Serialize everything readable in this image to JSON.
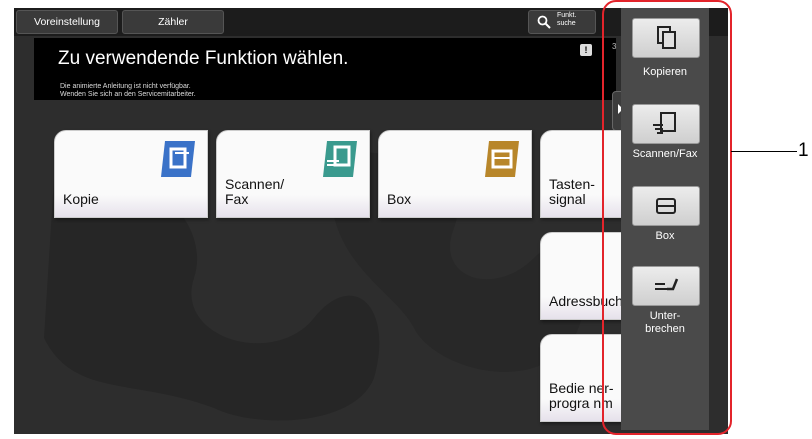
{
  "topbar": {
    "preset_label": "Voreinstellung",
    "counter_label": "Zähler",
    "search_label_line1": "Funkt.",
    "search_label_line2": "suche",
    "right_number": "3"
  },
  "header": {
    "title": "Zu verwendende Funktion wählen.",
    "notice_line1": "Die animierte Anleitung ist nicht verfügbar.",
    "notice_line2": "Wenden Sie sich an den Servicemitarbeiter."
  },
  "tiles": [
    {
      "label": "Kopie",
      "icon": "copy-icon",
      "color": "#3a72c8"
    },
    {
      "label": "Scannen/\nFax",
      "icon": "scan-fax-icon",
      "color": "#3a9a8e"
    },
    {
      "label": "Box",
      "icon": "box-icon",
      "color": "#b8862a"
    },
    {
      "label": "Tasten-\nsignal",
      "icon": "",
      "color": ""
    },
    {
      "label": "Adressbuch",
      "icon": "",
      "color": ""
    },
    {
      "label": "Bedie ner-\nprogra nm",
      "icon": "",
      "color": ""
    }
  ],
  "side_panel": {
    "items": [
      {
        "label": "Kopieren",
        "icon": "copy-icon"
      },
      {
        "label": "Scannen/Fax",
        "icon": "scan-fax-icon"
      },
      {
        "label": "Box",
        "icon": "box-icon"
      },
      {
        "label": "Unter-\nbrechen",
        "icon": "interrupt-icon"
      }
    ]
  },
  "callout": {
    "number": "1"
  }
}
